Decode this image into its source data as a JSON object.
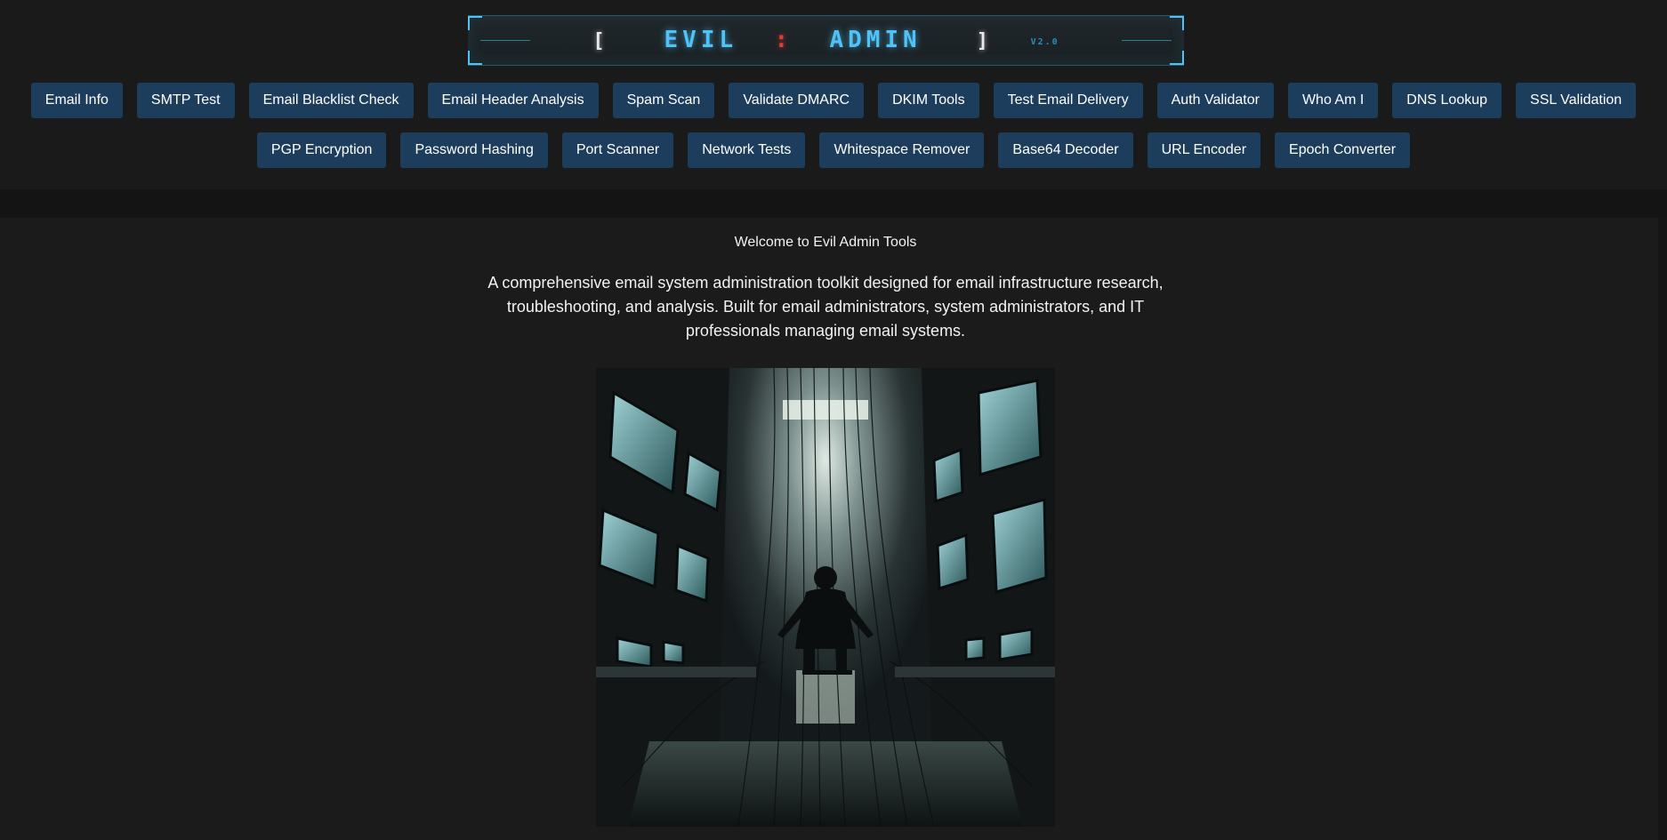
{
  "logo": {
    "bracket_open": "[",
    "word1": "EVIL",
    "separator": ":",
    "word2": "ADMIN",
    "bracket_close": "]",
    "version": "V2.0"
  },
  "nav": {
    "row1": [
      "Email Info",
      "SMTP Test",
      "Email Blacklist Check",
      "Email Header Analysis",
      "Spam Scan",
      "Validate DMARC",
      "DKIM Tools",
      "Test Email Delivery",
      "Auth Validator",
      "Who Am I",
      "DNS Lookup",
      "SSL Validation"
    ],
    "row2": [
      "PGP Encryption",
      "Password Hashing",
      "Port Scanner",
      "Network Tests",
      "Whitespace Remover",
      "Base64 Decoder",
      "URL Encoder",
      "Epoch Converter"
    ]
  },
  "main": {
    "welcome": "Welcome to Evil Admin Tools",
    "description": "A comprehensive email system administration toolkit designed for email infrastructure research, troubleshooting, and analysis. Built for email administrators, system administrators, and IT professionals managing email systems."
  },
  "colors": {
    "background": "#1a1a1a",
    "button": "#1d3d5c",
    "accent": "#4fc3f7",
    "separator": "#e53935"
  }
}
